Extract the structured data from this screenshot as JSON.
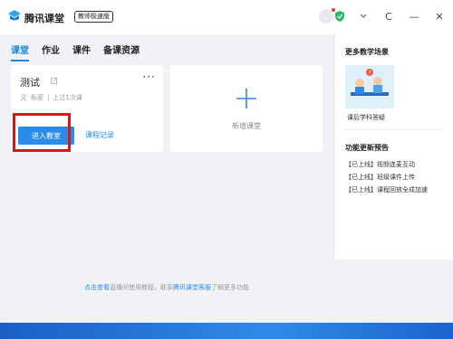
{
  "app": {
    "name": "腾讯课堂",
    "edition_badge": "教师极速版"
  },
  "title_controls": {
    "refresh_glyph": "C",
    "minimize_glyph": "—",
    "close_glyph": "✕"
  },
  "nav": {
    "tabs": [
      {
        "label": "课堂",
        "active": true
      },
      {
        "label": "作业",
        "active": false
      },
      {
        "label": "课件",
        "active": false
      },
      {
        "label": "备课资源",
        "active": false
      }
    ]
  },
  "class_card": {
    "title": "测试",
    "more_glyph": "···",
    "privacy": "私密",
    "last_time": "上过1次课",
    "enter_button": "进入教室",
    "record_link": "课程记录"
  },
  "add_card": {
    "label": "新增课堂"
  },
  "footer": {
    "link1": "点击查看",
    "text1": "直播间使用教程，联系",
    "link2": "腾讯课堂客服",
    "text2": "了解更多功能"
  },
  "right_panel": {
    "more_scenes_title": "更多教学场景",
    "scene_label": "课后学科答疑",
    "updates_title": "功能更新预告",
    "updates": [
      "【已上线】视频连麦互动",
      "【已上线】班级课件上传",
      "【已上线】课程回放全成加速"
    ]
  },
  "colors": {
    "accent": "#2a8be8",
    "highlight": "#d01a1a",
    "desktop": "#1e6fd6"
  }
}
